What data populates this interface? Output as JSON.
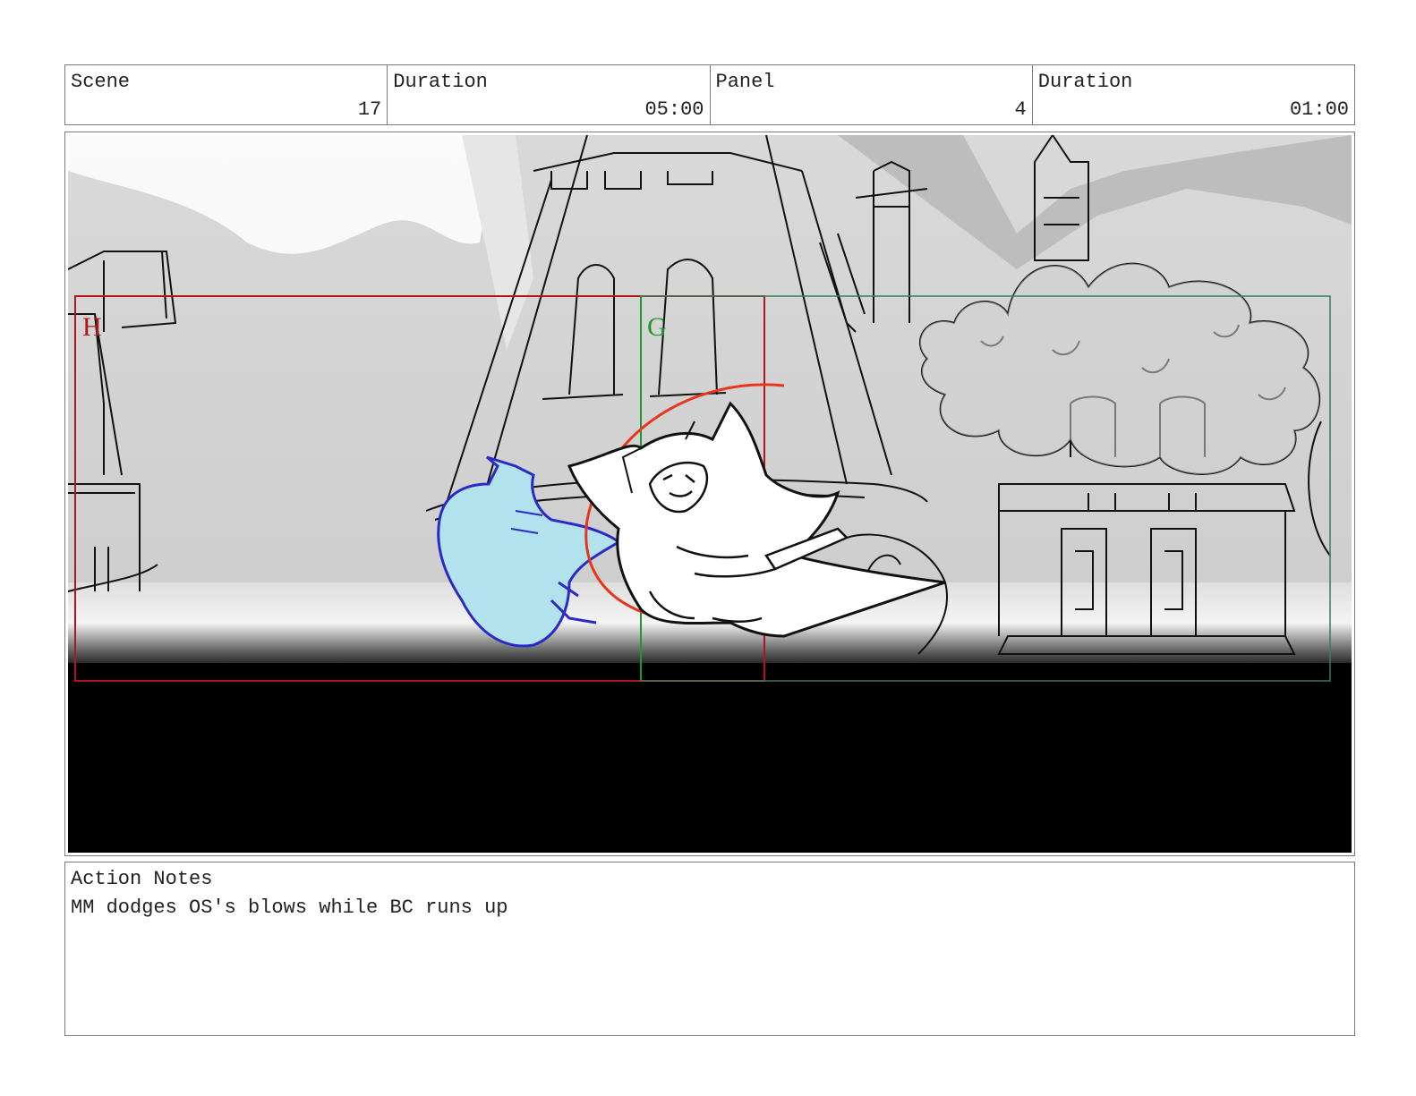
{
  "header": {
    "scene_label": "Scene",
    "scene_value": "17",
    "duration_label": "Duration",
    "duration_value": "05:00",
    "panel_label": "Panel",
    "panel_value": "4",
    "panel_duration_label": "Duration",
    "panel_duration_value": "01:00"
  },
  "frame": {
    "marker_h": "H",
    "marker_g": "G",
    "colors": {
      "frame_h": "#b0161c",
      "frame_g": "#1a9b2a",
      "frame_teal": "#3a7a5c",
      "character_blue": "#2a2ac8",
      "character_blue_fill": "#b2e2ee",
      "action_red": "#e8361c",
      "letterbox": "#000000"
    }
  },
  "notes": {
    "label": "Action Notes",
    "text": "MM dodges OS's blows while BC runs up"
  }
}
